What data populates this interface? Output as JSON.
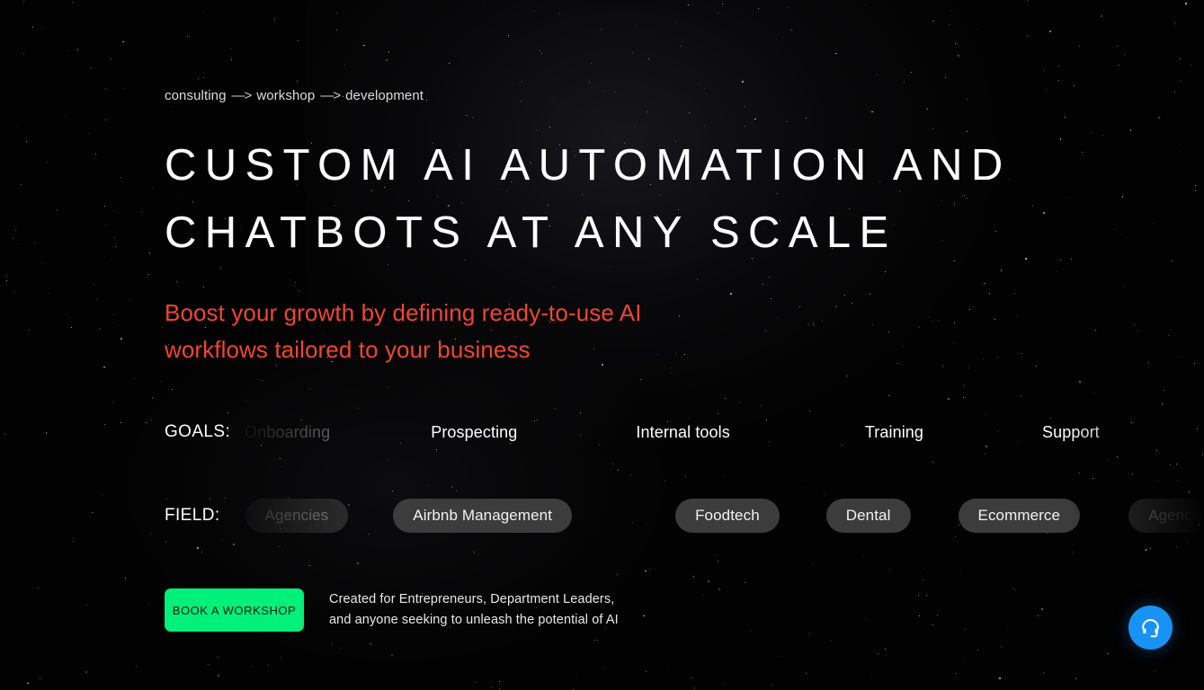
{
  "page": {
    "background_color": "#000000",
    "accent_red": "#f2452f",
    "accent_green": "#00f07a",
    "chat_blue": "#1893f5"
  },
  "breadcrumb": {
    "items": [
      "consulting",
      "workshop",
      "development"
    ],
    "separator": "—>"
  },
  "hero": {
    "headline": "CUSTOM AI AUTOMATION AND\nCHATBOTS AT ANY SCALE",
    "subtitle": "Boost your growth by defining ready-to-use AI\nworkflows tailored to your business"
  },
  "goals": {
    "label": "GOALS:",
    "items": [
      {
        "text": "Onboarding",
        "dim": true
      },
      {
        "text": "Prospecting",
        "dim": false
      },
      {
        "text": "Internal tools",
        "dim": false
      },
      {
        "text": "Training",
        "dim": false
      },
      {
        "text": "Support",
        "dim": false
      },
      {
        "text": "Onboarding",
        "dim": false
      },
      {
        "text": "Prospecting",
        "dim": true
      }
    ]
  },
  "field": {
    "label": "FIELD:",
    "items": [
      {
        "text": "Agencies",
        "dim": true
      },
      {
        "text": "Airbnb Management",
        "dim": false
      },
      {
        "text": "Foodtech",
        "dim": false
      },
      {
        "text": "Dental",
        "dim": false
      },
      {
        "text": "Ecommerce",
        "dim": false
      },
      {
        "text": "Agencies",
        "dim": true
      }
    ]
  },
  "cta": {
    "button_label": "BOOK A WORKSHOP",
    "caption": "Created for Entrepreneurs, Department Leaders,\nand anyone seeking to unleash the potential of AI"
  },
  "chat": {
    "icon": "headset-icon",
    "label": "Support chat"
  }
}
